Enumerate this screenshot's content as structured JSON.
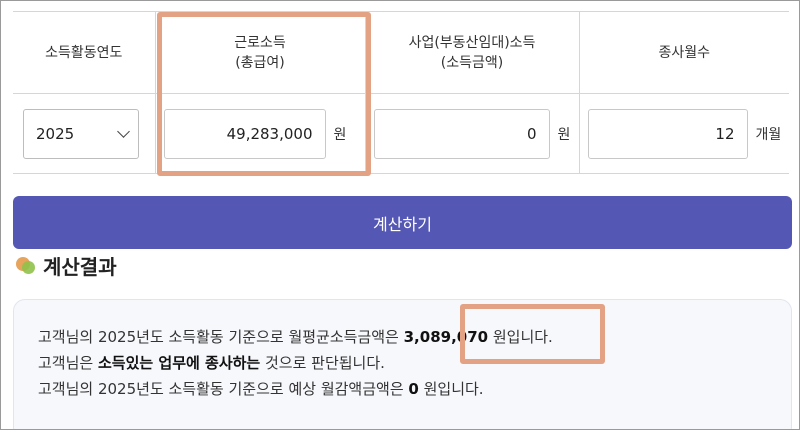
{
  "table": {
    "headers": {
      "year": [
        "소득활동연도"
      ],
      "earned": [
        "근로소득",
        "(총급여)"
      ],
      "business": [
        "사업(부동산임대)소득",
        "(소득금액)"
      ],
      "months": [
        "종사월수"
      ]
    },
    "year_select": {
      "value": "2025"
    },
    "earned_income": {
      "value": "49,283,000",
      "unit": "원"
    },
    "business_income": {
      "value": "0",
      "unit": "원"
    },
    "months_worked": {
      "value": "12",
      "unit": "개월"
    }
  },
  "calc_button": {
    "label": "계산하기"
  },
  "result": {
    "title": "계산결과",
    "line1": {
      "pre": "고객님의 2025년도 소득활동 기준으로 월평균소득금액은 ",
      "amount": "3,089,070",
      "post": " 원입니다."
    },
    "line2": {
      "pre": "고객님은 ",
      "bold": "소득있는 업무에 종사하는",
      "post": " 것으로 판단됩니다."
    },
    "line3": {
      "pre": "고객님의 2025년도 소득활동 기준으로 예상 월감액금액은 ",
      "amount": "0",
      "post": " 원입니다."
    }
  },
  "highlight_color": "#e3a283",
  "accent_color": "#5457b3"
}
